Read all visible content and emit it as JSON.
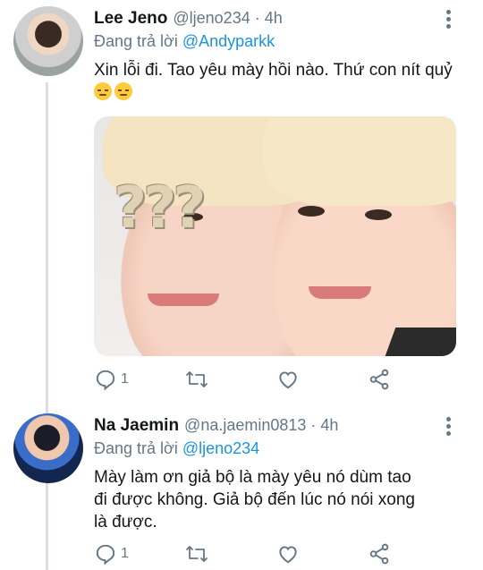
{
  "tweets": [
    {
      "name": "Lee Jeno",
      "handle": "@ljeno234 · 4h",
      "reply_prefix": "Đang trả lời ",
      "reply_to": "@Andyparkk",
      "text": "Xin lỗi đi. Tao yêu mày hồi nào. Thứ con nít quỷ",
      "emoji": [
        "smirking-face",
        "smirking-face"
      ],
      "image_overlay_text": "???",
      "reply_count": "1"
    },
    {
      "name": "Na Jaemin",
      "handle": "@na.jaemin0813 · 4h",
      "reply_prefix": "Đang trả lời ",
      "reply_to": "@ljeno234",
      "text": "Mày làm ơn giả bộ là mày yêu nó dùm tao đi được không. Giả bộ đến lúc nó nói xong là được.",
      "reply_count": "1"
    }
  ],
  "colors": {
    "link": "#1b95e0",
    "muted": "#657786",
    "text": "#14171a",
    "thread_line": "#d8dde2"
  },
  "icons": [
    "more-icon",
    "reply-icon",
    "retweet-icon",
    "like-icon",
    "share-icon"
  ]
}
